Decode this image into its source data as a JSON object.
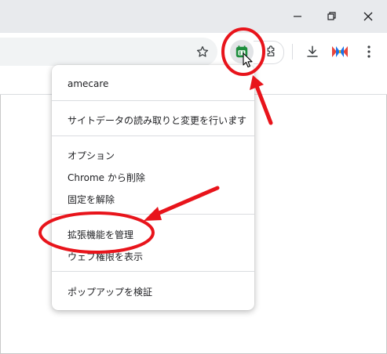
{
  "menu": {
    "title": "amecare",
    "items": [
      {
        "label": "サイトデータの読み取りと変更を行います",
        "chevron": "›"
      },
      {
        "label": "オプション"
      },
      {
        "label": "Chrome から削除"
      },
      {
        "label": "固定を解除"
      },
      {
        "label": "拡張機能を管理"
      },
      {
        "label": "ウェブ権限を表示"
      },
      {
        "label": "ポップアップを検証"
      }
    ]
  },
  "icons": {
    "minimize": "minimize-icon",
    "restore": "restore-icon",
    "close": "close-icon",
    "star": "star-icon",
    "extension_app": "amecare-extension-icon",
    "extensions": "puzzle-icon",
    "download": "download-icon",
    "profile": "profile-icon",
    "more": "more-vert-icon"
  },
  "colors": {
    "annotation": "#e8141b",
    "extension_green": "#1e8e3e",
    "titlebar": "#e8eaed"
  }
}
